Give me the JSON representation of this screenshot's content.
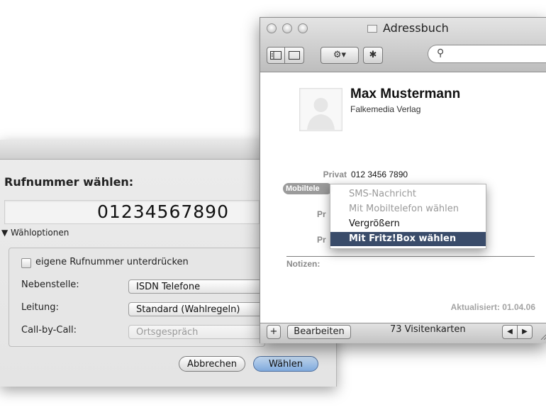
{
  "dial_dialog": {
    "title": "Rufnummer wählen:",
    "number": "01234567890",
    "options_toggle": "▼ Wähloptionen",
    "suppress_number_label": "eigene Rufnummer unterdrücken",
    "extension_label": "Nebenstelle:",
    "extension_value": "ISDN Telefone",
    "line_label": "Leitung:",
    "line_value": "Standard (Wahlregeln)",
    "callbycall_label": "Call-by-Call:",
    "callbycall_value": "Ortsgespräch",
    "cancel_button": "Abbrechen",
    "dial_button": "Wählen"
  },
  "address_book": {
    "window_title": "Adressbuch",
    "toolbar": {
      "action_icon": "⚙▾",
      "bluetooth_icon": "✱"
    },
    "search_icon_glyph": "⚲",
    "contact": {
      "name": "Max Mustermann",
      "company": "Falkemedia Verlag",
      "private_label": "Privat",
      "private_number": "012 3456 7890",
      "mobile_label": "Mobiltele",
      "pr_label_1": "Pr",
      "pr_label_2": "Pr"
    },
    "notes_label": "Notizen:",
    "updated": "Aktualisiert: 01.04.06",
    "bottombar": {
      "add_button": "+",
      "edit_button": "Bearbeiten",
      "card_count": "73 Visitenkarten",
      "prev_icon": "◀",
      "next_icon": "▶"
    }
  },
  "context_menu": {
    "items": [
      {
        "label": "SMS-Nachricht",
        "state": "disabled"
      },
      {
        "label": "Mit Mobiltelefon wählen",
        "state": "disabled"
      },
      {
        "label": "Vergrößern",
        "state": "enabled"
      },
      {
        "label": "Mit Fritz!Box wählen",
        "state": "selected"
      }
    ]
  },
  "colors": {
    "menu_highlight": "#3a4c6a",
    "dial_button": "#7ea8db"
  }
}
